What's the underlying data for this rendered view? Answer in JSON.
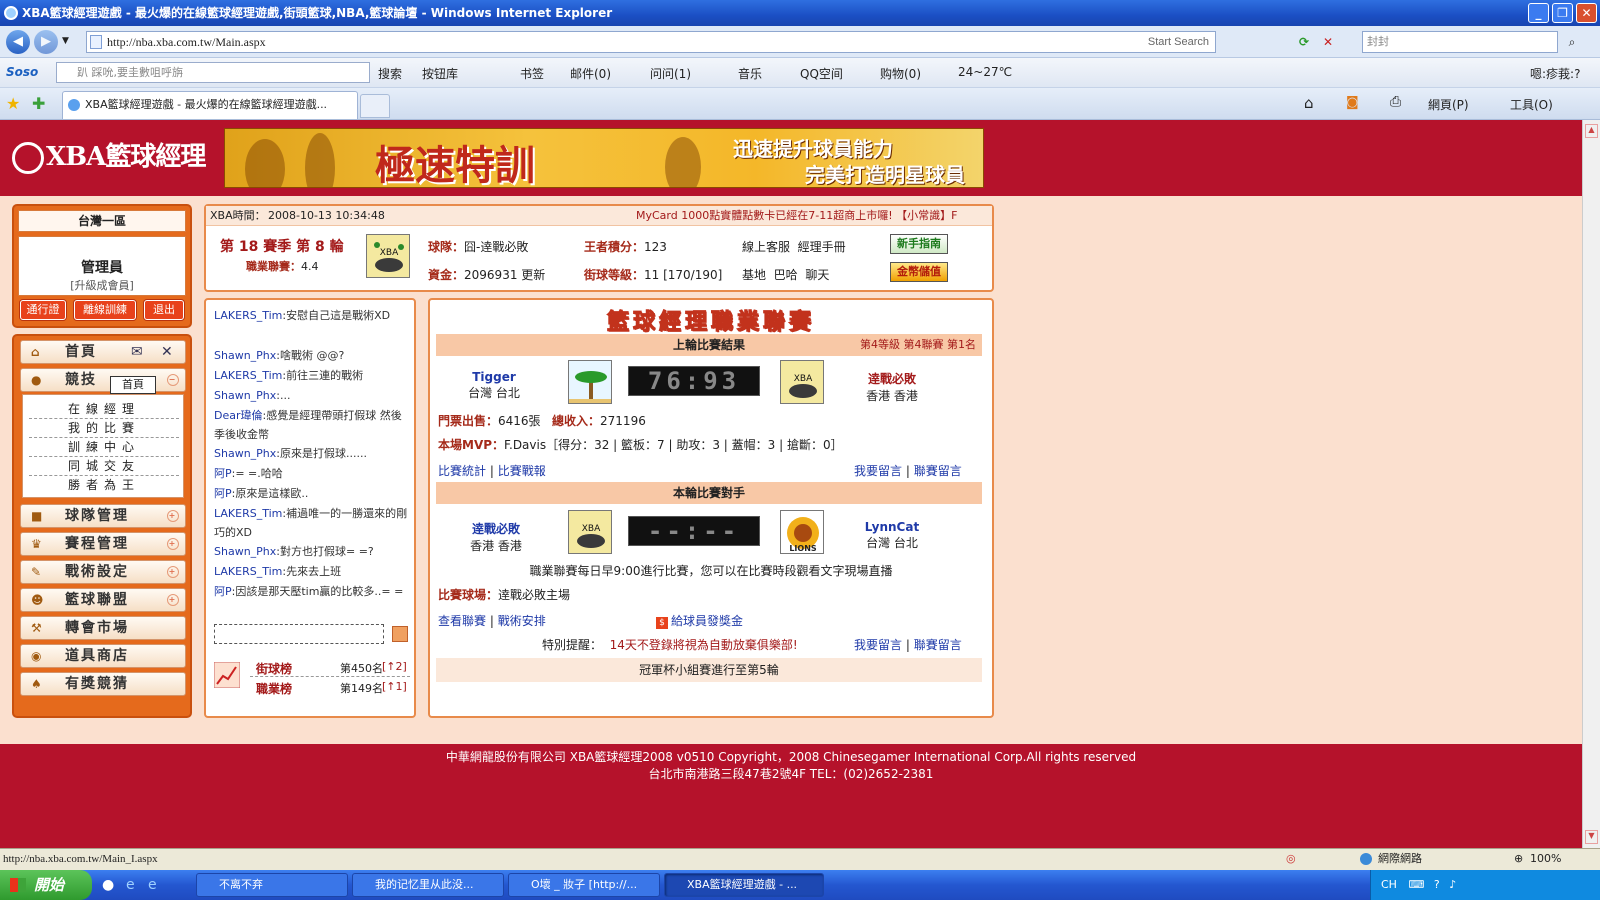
{
  "window": {
    "title": "XBA籃球經理遊戲 - 最火爆的在線籃球經理遊戲,街頭籃球,NBA,籃球論壇 - Windows Internet Explorer"
  },
  "address": {
    "url": "http://nba.xba.com.tw/Main.aspx",
    "search_placeholder": "Start Search",
    "search2_value": "封封"
  },
  "toolbar2": {
    "soso": "Soso",
    "soso_placeholder": "趴     踩吮,要圭數咀呼旃",
    "search": "搜索",
    "items": [
      "按钮库",
      "书签",
      "邮件(0)",
      "问问(1)",
      "音乐",
      "QQ空间",
      "购物(0)",
      "24~27℃"
    ],
    "right": "嗯:疹莪:?"
  },
  "tabs": {
    "active": "XBA籃球經理遊戲 - 最火爆的在線籃球經理遊戲...",
    "page_menu": "網頁(P)",
    "tools_menu": "工具(O)"
  },
  "header": {
    "logo": "XBA籃球經理",
    "banner_main": "極速特訓",
    "banner_line1": "迅速提升球員能力",
    "banner_line2": "完美打造明星球員"
  },
  "user": {
    "server": "台灣一區",
    "name": "管理員",
    "upgrade": "[升級成會員]",
    "btn_pass": "通行證",
    "btn_offline": "離線訓練",
    "btn_exit": "退出"
  },
  "menu": {
    "home": "首頁",
    "tooltip": "首頁",
    "compete": "競技",
    "sub": [
      "在線經理",
      "我的比賽",
      "訓練中心",
      "同城交友",
      "勝者為王"
    ],
    "items": [
      "球隊管理",
      "賽程管理",
      "戰術設定",
      "籃球聯盟",
      "轉會市場",
      "道具商店",
      "有獎競猜"
    ]
  },
  "info": {
    "time_label": "XBA時間：",
    "time": "2008-10-13 10:34:48",
    "marquee": "MyCard 1000點實體點數卡已經在7-11超商上市囉! 【小常識】F",
    "season": "第 18 賽季  第 8 輪",
    "league_label": "職業聯賽：",
    "league": "4.4",
    "team_label": "球隊：",
    "team": "囧-逹戰必敗",
    "king_label": "王者積分：",
    "king": "123",
    "online_service": "線上客服",
    "manual": "經理手冊",
    "funds_label": "資金：",
    "funds": "2096931",
    "update": "更新",
    "street_label": "街球等級：",
    "street": "11 [170/190]",
    "base": "基地",
    "bar": "巴哈",
    "chat": "聊天",
    "btn_guide": "新手指南",
    "btn_recharge": "金幣儲值"
  },
  "chat": {
    "lines": [
      {
        "name": "LAKERS_Tim",
        "msg": ":安慰自己這是戰術XD"
      },
      {
        "name": "Shawn_Phx",
        "msg": ":啥戰術 @@?"
      },
      {
        "name": "LAKERS_Tim",
        "msg": ":前往三連的戰術"
      },
      {
        "name": "Shawn_Phx",
        "msg": ":..."
      },
      {
        "name": "Dear瑋倫",
        "msg": ":感覺是經理帶頭打假球 然後季後收金幣"
      },
      {
        "name": "Shawn_Phx",
        "msg": ":原來是打假球......"
      },
      {
        "name": "阿P",
        "msg": ":= =.哈哈"
      },
      {
        "name": "阿P",
        "msg": ":原來是這樣歐.."
      },
      {
        "name": "LAKERS_Tim",
        "msg": ":補過唯一的一勝還來的剛巧的XD"
      },
      {
        "name": "Shawn_Phx",
        "msg": ":對方也打假球= =?"
      },
      {
        "name": "LAKERS_Tim",
        "msg": ":先來去上班"
      },
      {
        "name": "阿P",
        "msg": ":因該是那天壓tim贏的比較多..= ="
      }
    ],
    "rank1_label": "街球榜",
    "rank1": "第450名",
    "rank1_change": "[↑2]",
    "rank2_label": "職業榜",
    "rank2": "第149名",
    "rank2_change": "[↑1]"
  },
  "league": {
    "title": "籃球經理職業聯賽",
    "last_title": "上輪比賽結果",
    "last_meta": "第4等級  第4聯賽  第1名",
    "home_team": "Tigger",
    "home_loc": "台灣 台北",
    "away_team": "逹戰必敗",
    "away_loc": "香港 香港",
    "score": "76:93",
    "tickets_label": "門票出售：",
    "tickets": "6416張",
    "income_label": "總收入：",
    "income": "271196",
    "mvp_label": "本場MVP：",
    "mvp": "F.Davis［得分：32 | 籃板：7 | 助攻：3 | 蓋帽：3 | 搶斷：0］",
    "link_stats": "比賽統計",
    "link_report": "比賽戰報",
    "link_msg": "我要留言",
    "link_league_msg": "聯賽留言",
    "next_title": "本輪比賽對手",
    "next_home": "逹戰必敗",
    "next_home_loc": "香港 香港",
    "next_away": "LynnCat",
    "next_away_loc": "台灣 台北",
    "next_score": "--:--",
    "notice": "職業聯賽每日早9:00進行比賽，您可以在比賽時段觀看文字現場直播",
    "venue_label": "比賽球場：",
    "venue": "逹戰必敗主場",
    "link_view": "查看聯賽",
    "link_tactics": "戰術安排",
    "bonus": "給球員發獎金",
    "warn_label": "特別提醒：",
    "warn": "14天不登錄將視為自動放棄俱樂部!",
    "link_msg2": "我要留言",
    "link_league_msg2": "聯賽留言",
    "cup": "冠軍杯小組賽進行至第5輪"
  },
  "footer": {
    "line1": "中華網龍股份有限公司  XBA籃球經理2008 v0510     Copyright，2008 Chinesegamer International Corp.All rights reserved",
    "line2": "台北市南港路三段47巷2號4F TEL：(02)2652-2381"
  },
  "status": {
    "url": "http://nba.xba.com.tw/Main_I.aspx",
    "zone": "網際網路",
    "zoom": "100%"
  },
  "taskbar": {
    "start": "開始",
    "tasks": [
      "不离不弃",
      "我的记忆里从此没...",
      "O壞 _ 妝子 [http://...",
      "XBA籃球經理遊戲 - ..."
    ],
    "tray_lang": "CH"
  },
  "colors": {
    "brand_red": "#b5122b",
    "panel_orange": "#e56a1c",
    "page_bg": "#fbe0cf",
    "link_blue": "#1f3aa8"
  }
}
